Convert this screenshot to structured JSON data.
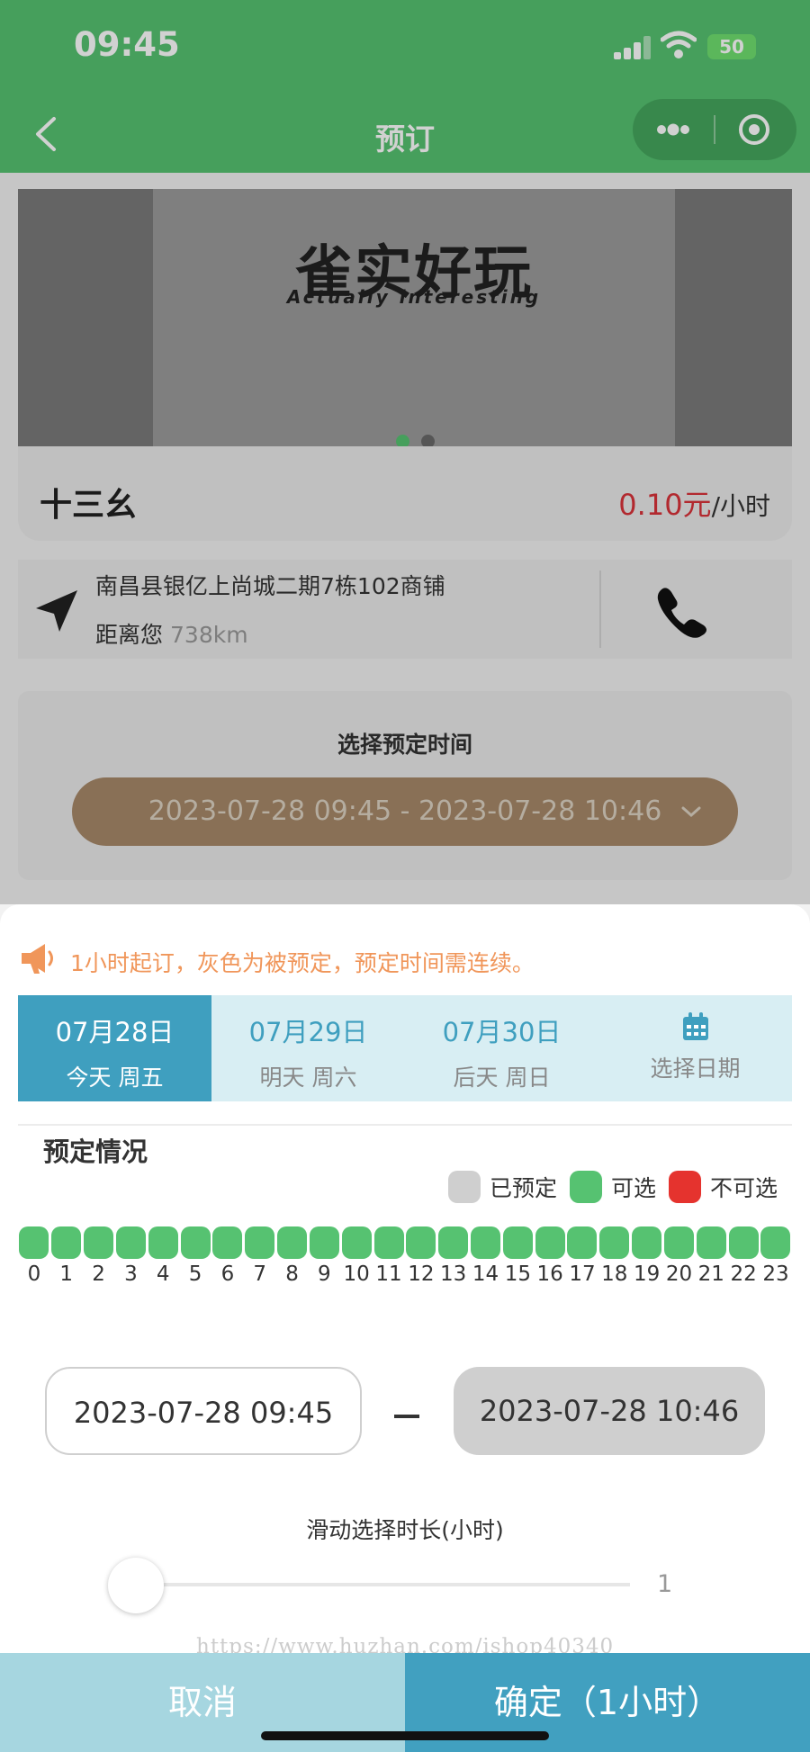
{
  "status_bar": {
    "time": "09:45",
    "battery": "50",
    "icons": [
      "signal-icon",
      "wifi-icon",
      "battery-icon"
    ]
  },
  "nav": {
    "title": "预订",
    "back_icon": "chevron-left-icon",
    "more_icon": "more-dots-icon",
    "close_icon": "target-circle-icon"
  },
  "banner": {
    "sign_text": "雀实好玩",
    "sign_subtext": "Actually interesting",
    "slide_count": 2,
    "active_slide": 1
  },
  "shop": {
    "name": "十三幺",
    "price": "0.10元",
    "unit": "/小时"
  },
  "address": {
    "text": "南昌县银亿上尚城二期7栋102商铺",
    "distance_label": "距离您",
    "distance_value": "738km",
    "nav_icon": "navigation-arrow-icon",
    "phone_icon": "phone-icon"
  },
  "time_select": {
    "title": "选择预定时间",
    "range": "2023-07-28 09:45 - 2023-07-28 10:46"
  },
  "sheet": {
    "notice": "1小时起订，灰色为被预定，预定时间需连续。",
    "date_tabs": [
      {
        "date": "07月28日",
        "weekday": "今天 周五",
        "active": true
      },
      {
        "date": "07月29日",
        "weekday": "明天 周六",
        "active": false
      },
      {
        "date": "07月30日",
        "weekday": "后天 周日",
        "active": false
      }
    ],
    "pick_date_label": "选择日期",
    "status_title": "预定情况",
    "legend": [
      {
        "label": "已预定",
        "color": "#cfcfcf"
      },
      {
        "label": "可选",
        "color": "#56c271"
      },
      {
        "label": "不可选",
        "color": "#e5332e"
      }
    ],
    "hours": [
      "0",
      "1",
      "2",
      "3",
      "4",
      "5",
      "6",
      "7",
      "8",
      "9",
      "10",
      "11",
      "12",
      "13",
      "14",
      "15",
      "16",
      "17",
      "18",
      "19",
      "20",
      "21",
      "22",
      "23"
    ],
    "hour_status": [
      "available",
      "available",
      "available",
      "available",
      "available",
      "available",
      "available",
      "available",
      "available",
      "available",
      "available",
      "available",
      "available",
      "available",
      "available",
      "available",
      "available",
      "available",
      "available",
      "available",
      "available",
      "available",
      "available",
      "available"
    ],
    "start_time": "2023-07-28 09:45",
    "end_time": "2023-07-28 10:46",
    "slider_label": "滑动选择时长(小时)",
    "slider_value": "1",
    "watermark": "https://www.huzhan.com/ishop40340",
    "cancel_label": "取消",
    "confirm_label": "确定（1小时）"
  },
  "colors": {
    "brand_green": "#56c271",
    "accent_blue": "#41a0c0",
    "price_red": "#d9323a",
    "notice_orange": "#f0965a"
  }
}
